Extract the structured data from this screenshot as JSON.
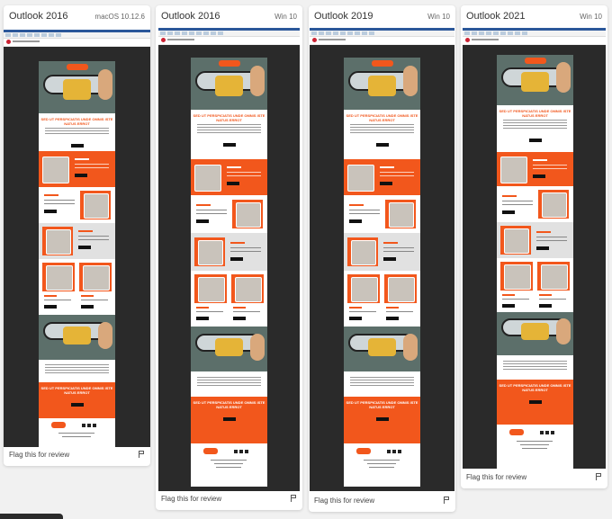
{
  "cards": [
    {
      "title": "Outlook 2016",
      "meta": "macOS 10.12.6",
      "flag": "Flag this for review",
      "headline": "SED UT PERSPICIATIS UNDE OMNIS ISTE NATUS ERROT",
      "footer_headline": "SED UT PERSPICIATIS UNDE OMNIS ISTE NATUS ERROT"
    },
    {
      "title": "Outlook 2016",
      "meta": "Win 10",
      "flag": "Flag this for review",
      "headline": "SED UT PERSPICIATIS UNDE OMNIS ISTE NATUS ERROT",
      "footer_headline": "SED UT PERSPICIATIS UNDE OMNIS ISTE NATUS ERROT"
    },
    {
      "title": "Outlook 2019",
      "meta": "Win 10",
      "flag": "Flag this for review",
      "headline": "SED UT PERSPICIATIS UNDE OMNIS ISTE NATUS ERROT",
      "footer_headline": "SED UT PERSPICIATIS UNDE OMNIS ISTE NATUS ERROT"
    },
    {
      "title": "Outlook 2021",
      "meta": "Win 10",
      "flag": "Flag this for review",
      "headline": "SED UT PERSPICIATIS UNDE OMNIS ISTE NATUS ERROT",
      "footer_headline": "SED UT PERSPICIATIS UNDE OMNIS ISTE NATUS ERROT"
    }
  ],
  "icons": {
    "flag": "flag-icon",
    "logo": "brand-logo"
  },
  "colors": {
    "accent": "#f2571c",
    "dark_bg": "#2a2a2a"
  }
}
